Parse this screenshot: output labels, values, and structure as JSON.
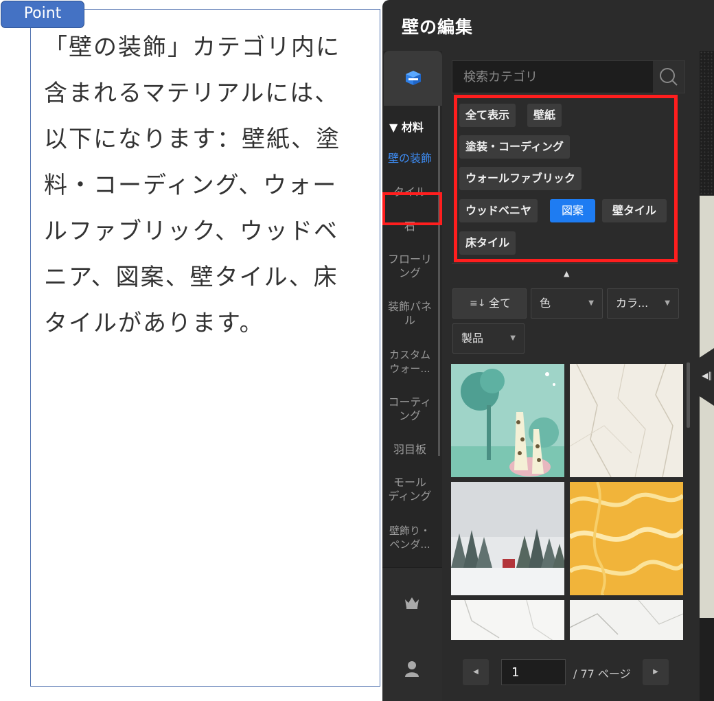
{
  "note": {
    "badge": "Point",
    "text": "「壁の装飾」カテゴリ内に含まれるマテリアルには、以下になります：壁紙、塗料・コーディング、ウォールファブリック、ウッドベニア、図案、壁タイル、床タイルがあります。"
  },
  "editor": {
    "title": "壁の編集",
    "rail": {
      "section": "▼ 材料",
      "items": [
        {
          "label": "壁の装飾",
          "active": true
        },
        {
          "label": "タイル"
        },
        {
          "label": "石"
        },
        {
          "label": "フローリング"
        },
        {
          "label": "装飾パネル"
        },
        {
          "label": "カスタムウォー..."
        },
        {
          "label": "コーティング"
        },
        {
          "label": "羽目板"
        },
        {
          "label": "モールディング"
        },
        {
          "label": "壁飾り・ペンダ..."
        }
      ]
    },
    "search": {
      "placeholder": "検索カテゴリ"
    },
    "tags": [
      "全て表示",
      "壁紙",
      "塗装・コーディング",
      "ウォールファブリック",
      "ウッドベニヤ",
      "図案",
      "壁タイル",
      "床タイル"
    ],
    "selected_tag": "図案",
    "filters": {
      "sort": "全て",
      "color": "色",
      "category": "カラ...",
      "product": "製品"
    },
    "pagination": {
      "current": "1",
      "total": "/ 77 ページ"
    },
    "colors": {
      "accent": "#1e7cf2",
      "highlight": "#ff1e1e",
      "panel": "#2b2b2b"
    }
  }
}
